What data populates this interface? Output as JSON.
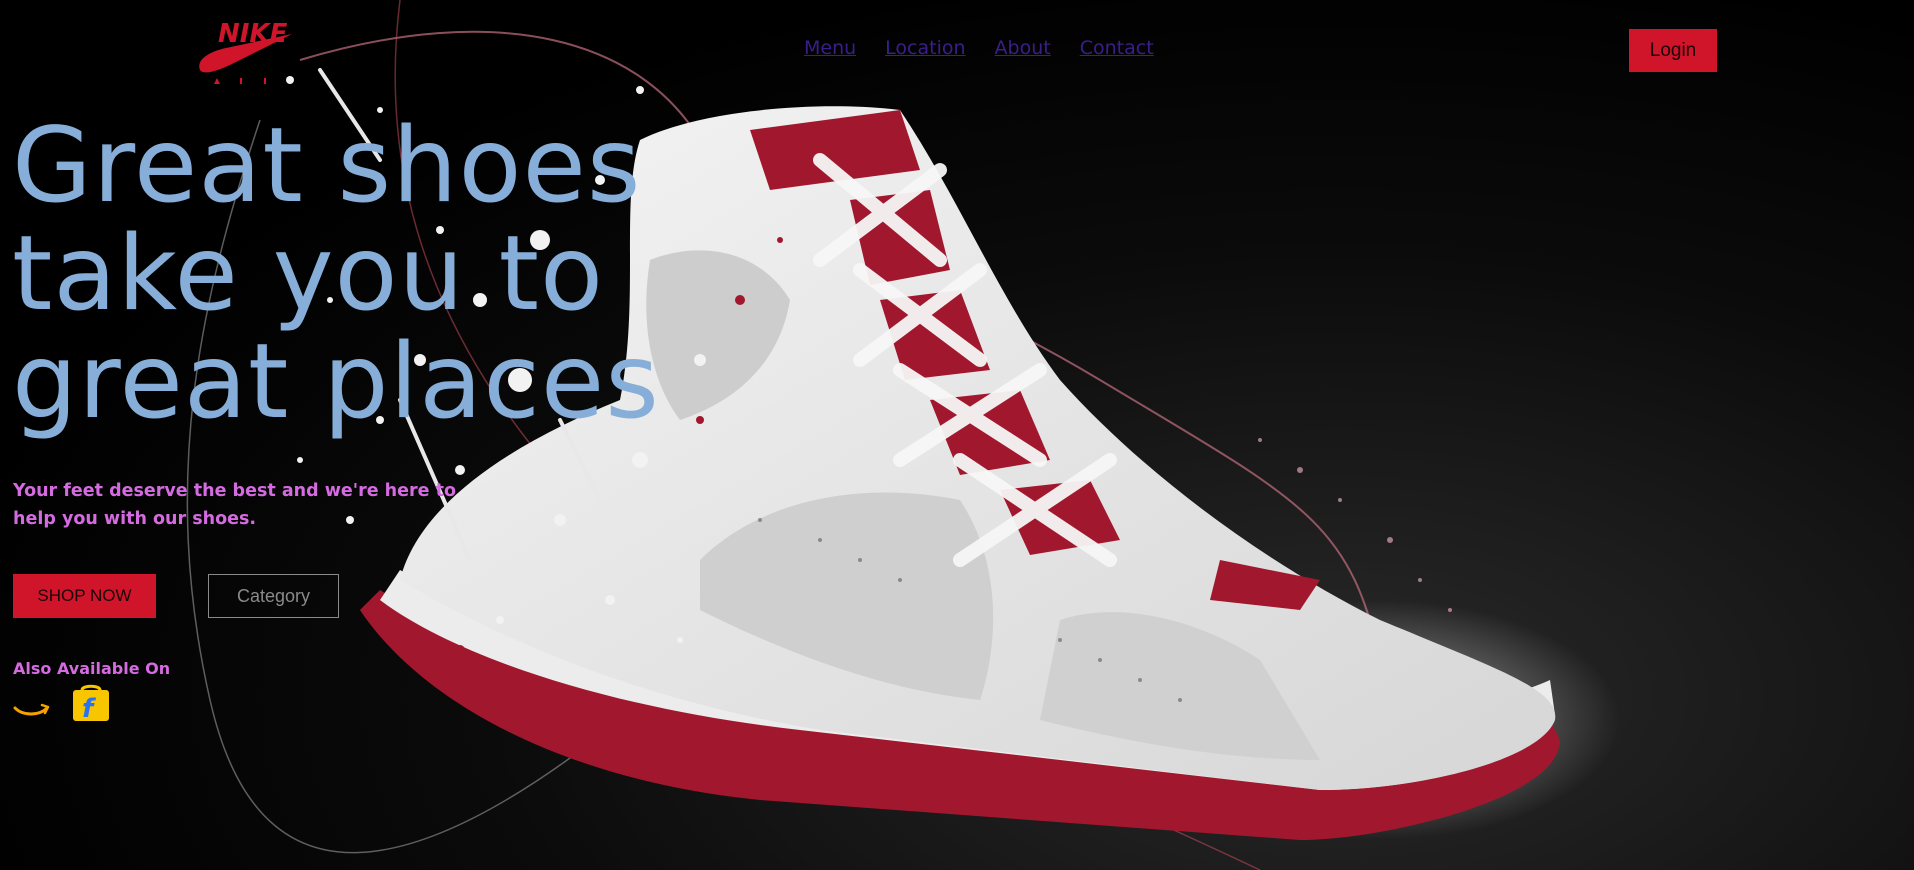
{
  "brand": {
    "logo_icon": "nike-air-logo",
    "colors": {
      "accent": "#d0142a",
      "headline": "#86aed8",
      "subtext": "#d46be0",
      "nav_link": "#3a1f8a"
    }
  },
  "nav": {
    "links": [
      {
        "label": "Menu"
      },
      {
        "label": "Location"
      },
      {
        "label": "About"
      },
      {
        "label": "Contact"
      }
    ],
    "login_label": "Login"
  },
  "hero": {
    "headline_lines": [
      "Great shoes",
      "take you to",
      "great places"
    ],
    "subtext": "Your feet deserve the best and we're here to help you with our shoes.",
    "shop_button": "SHOP NOW",
    "category_button": "Category",
    "also_available": "Also Available On",
    "stores": [
      {
        "icon": "amazon-icon"
      },
      {
        "icon": "flipkart-icon"
      }
    ]
  }
}
